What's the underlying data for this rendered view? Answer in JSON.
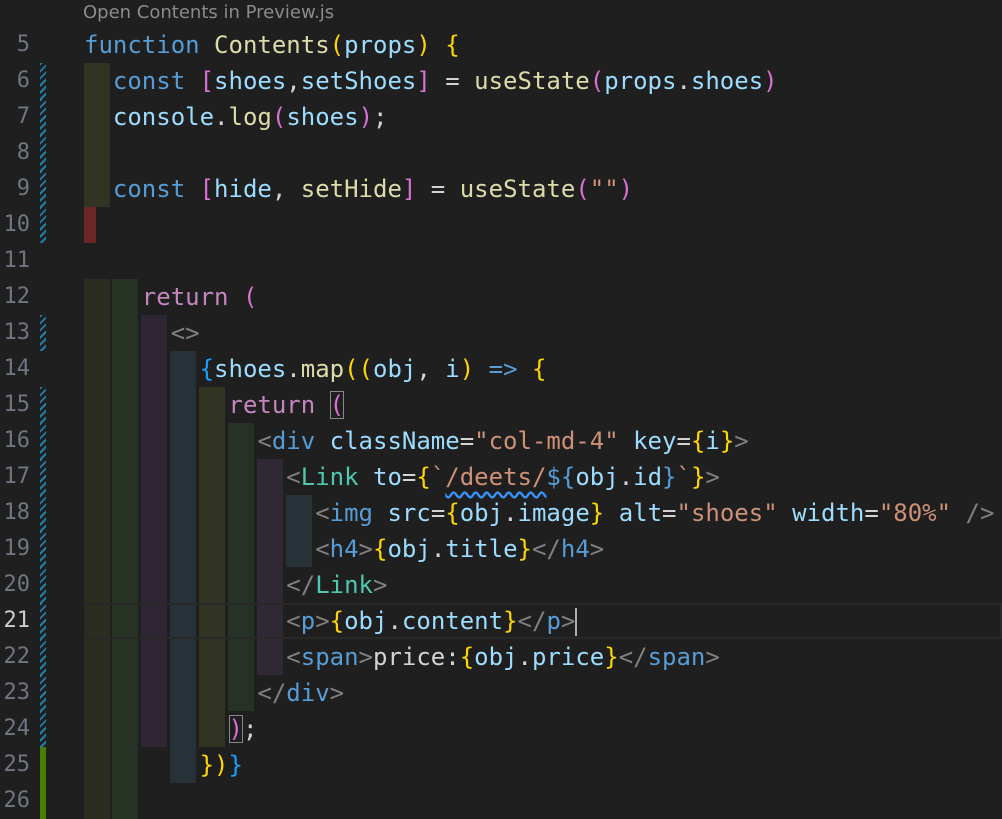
{
  "codelens": "Open Contents in Preview.js",
  "lines": [
    {
      "n": "5",
      "toks": [
        [
          "kw",
          "function"
        ],
        [
          "plain",
          " "
        ],
        [
          "fn",
          "Contents"
        ],
        [
          "b1",
          "("
        ],
        [
          "var",
          "props"
        ],
        [
          "b1",
          ")"
        ],
        [
          "plain",
          " "
        ],
        [
          "b1",
          "{"
        ]
      ]
    },
    {
      "n": "6",
      "toks": [
        [
          "kw",
          "const"
        ],
        [
          "plain",
          " "
        ],
        [
          "b2",
          "["
        ],
        [
          "var",
          "shoes"
        ],
        [
          "plain",
          ","
        ],
        [
          "var",
          "setShoes"
        ],
        [
          "b2",
          "]"
        ],
        [
          "plain",
          " = "
        ],
        [
          "fn",
          "useState"
        ],
        [
          "b2",
          "("
        ],
        [
          "var",
          "props"
        ],
        [
          "plain",
          "."
        ],
        [
          "var",
          "shoes"
        ],
        [
          "b2",
          ")"
        ]
      ]
    },
    {
      "n": "7",
      "toks": [
        [
          "var",
          "console"
        ],
        [
          "plain",
          "."
        ],
        [
          "fn",
          "log"
        ],
        [
          "b2",
          "("
        ],
        [
          "var",
          "shoes"
        ],
        [
          "b2",
          ")"
        ],
        [
          "plain",
          ";"
        ]
      ]
    },
    {
      "n": "8",
      "toks": []
    },
    {
      "n": "9",
      "toks": [
        [
          "kw",
          "const"
        ],
        [
          "plain",
          " "
        ],
        [
          "b2",
          "["
        ],
        [
          "var",
          "hide"
        ],
        [
          "plain",
          ", "
        ],
        [
          "fn",
          "setHide"
        ],
        [
          "b2",
          "]"
        ],
        [
          "plain",
          " = "
        ],
        [
          "fn",
          "useState"
        ],
        [
          "b2",
          "("
        ],
        [
          "str",
          "\"\""
        ],
        [
          "b2",
          ")"
        ]
      ]
    },
    {
      "n": "10",
      "toks": []
    },
    {
      "n": "11",
      "toks": []
    },
    {
      "n": "12",
      "toks": [
        [
          "ctl",
          "return"
        ],
        [
          "plain",
          " "
        ],
        [
          "b2",
          "("
        ]
      ]
    },
    {
      "n": "13",
      "toks": [
        [
          "punc",
          "<>"
        ]
      ]
    },
    {
      "n": "14",
      "toks": [
        [
          "b3",
          "{"
        ],
        [
          "var",
          "shoes"
        ],
        [
          "plain",
          "."
        ],
        [
          "fn",
          "map"
        ],
        [
          "b1",
          "(("
        ],
        [
          "var",
          "obj"
        ],
        [
          "plain",
          ", "
        ],
        [
          "var",
          "i"
        ],
        [
          "b1",
          ")"
        ],
        [
          "plain",
          " "
        ],
        [
          "kw",
          "=>"
        ],
        [
          "plain",
          " "
        ],
        [
          "b1",
          "{"
        ]
      ]
    },
    {
      "n": "15",
      "toks": [
        [
          "ctl",
          "return"
        ],
        [
          "plain",
          " "
        ],
        [
          "b2",
          "("
        ]
      ]
    },
    {
      "n": "16",
      "toks": [
        [
          "punc",
          "<"
        ],
        [
          "tag",
          "div"
        ],
        [
          "plain",
          " "
        ],
        [
          "attr",
          "className"
        ],
        [
          "plain",
          "="
        ],
        [
          "str",
          "\"col-md-4\""
        ],
        [
          "plain",
          " "
        ],
        [
          "attr",
          "key"
        ],
        [
          "plain",
          "="
        ],
        [
          "b1",
          "{"
        ],
        [
          "var",
          "i"
        ],
        [
          "b1",
          "}"
        ],
        [
          "punc",
          ">"
        ]
      ]
    },
    {
      "n": "17",
      "toks": [
        [
          "punc",
          "<"
        ],
        [
          "comp",
          "Link"
        ],
        [
          "plain",
          " "
        ],
        [
          "attr",
          "to"
        ],
        [
          "plain",
          "="
        ],
        [
          "b1",
          "{"
        ],
        [
          "str",
          "`"
        ],
        [
          "str",
          "/deets/"
        ],
        [
          "kw",
          "${"
        ],
        [
          "var",
          "obj"
        ],
        [
          "plain",
          "."
        ],
        [
          "var",
          "id"
        ],
        [
          "kw",
          "}"
        ],
        [
          "str",
          "`"
        ],
        [
          "b1",
          "}"
        ],
        [
          "punc",
          ">"
        ]
      ]
    },
    {
      "n": "18",
      "toks": [
        [
          "punc",
          "<"
        ],
        [
          "tag",
          "img"
        ],
        [
          "plain",
          " "
        ],
        [
          "attr",
          "src"
        ],
        [
          "plain",
          "="
        ],
        [
          "b1",
          "{"
        ],
        [
          "var",
          "obj"
        ],
        [
          "plain",
          "."
        ],
        [
          "var",
          "image"
        ],
        [
          "b1",
          "}"
        ],
        [
          "plain",
          " "
        ],
        [
          "attr",
          "alt"
        ],
        [
          "plain",
          "="
        ],
        [
          "str",
          "\"shoes\""
        ],
        [
          "plain",
          " "
        ],
        [
          "attr",
          "width"
        ],
        [
          "plain",
          "="
        ],
        [
          "str",
          "\"80%\""
        ],
        [
          "plain",
          " "
        ],
        [
          "punc",
          "/>"
        ]
      ]
    },
    {
      "n": "19",
      "toks": [
        [
          "punc",
          "<"
        ],
        [
          "tag",
          "h4"
        ],
        [
          "punc",
          ">"
        ],
        [
          "b1",
          "{"
        ],
        [
          "var",
          "obj"
        ],
        [
          "plain",
          "."
        ],
        [
          "var",
          "title"
        ],
        [
          "b1",
          "}"
        ],
        [
          "punc",
          "</"
        ],
        [
          "tag",
          "h4"
        ],
        [
          "punc",
          ">"
        ]
      ]
    },
    {
      "n": "20",
      "toks": [
        [
          "punc",
          "</"
        ],
        [
          "comp",
          "Link"
        ],
        [
          "punc",
          ">"
        ]
      ]
    },
    {
      "n": "21",
      "toks": [
        [
          "punc",
          "<"
        ],
        [
          "tag",
          "p"
        ],
        [
          "punc",
          ">"
        ],
        [
          "b1",
          "{"
        ],
        [
          "var",
          "obj"
        ],
        [
          "plain",
          "."
        ],
        [
          "var",
          "content"
        ],
        [
          "b1",
          "}"
        ],
        [
          "punc",
          "</"
        ],
        [
          "tag",
          "p"
        ],
        [
          "punc",
          ">"
        ]
      ]
    },
    {
      "n": "22",
      "toks": [
        [
          "punc",
          "<"
        ],
        [
          "tag",
          "span"
        ],
        [
          "punc",
          ">"
        ],
        [
          "plain",
          "price:"
        ],
        [
          "b1",
          "{"
        ],
        [
          "var",
          "obj"
        ],
        [
          "plain",
          "."
        ],
        [
          "var",
          "price"
        ],
        [
          "b1",
          "}"
        ],
        [
          "punc",
          "</"
        ],
        [
          "tag",
          "span"
        ],
        [
          "punc",
          ">"
        ]
      ]
    },
    {
      "n": "23",
      "toks": [
        [
          "punc",
          "</"
        ],
        [
          "tag",
          "div"
        ],
        [
          "punc",
          ">"
        ]
      ]
    },
    {
      "n": "24",
      "toks": [
        [
          "b2",
          ")"
        ],
        [
          "plain",
          ";"
        ]
      ]
    },
    {
      "n": "25",
      "toks": [
        [
          "b1",
          "})"
        ],
        [
          "b3",
          "}"
        ]
      ]
    },
    {
      "n": "26",
      "toks": []
    }
  ],
  "active_line": "21",
  "modified_lines": [
    "6",
    "7",
    "8",
    "9",
    "10",
    "13",
    "15",
    "16",
    "17",
    "18",
    "19",
    "20",
    "21",
    "22",
    "23",
    "24"
  ],
  "added_lines": [
    "25",
    "26"
  ],
  "colors": {
    "keyword": "#569cd6",
    "control": "#c586c0",
    "function": "#dcdcaa",
    "variable": "#9cdcfe",
    "string": "#ce9178",
    "component": "#4ec9b0",
    "bracket_gold": "#ffd700",
    "bracket_orchid": "#da70d6",
    "bracket_blue": "#179fff"
  }
}
